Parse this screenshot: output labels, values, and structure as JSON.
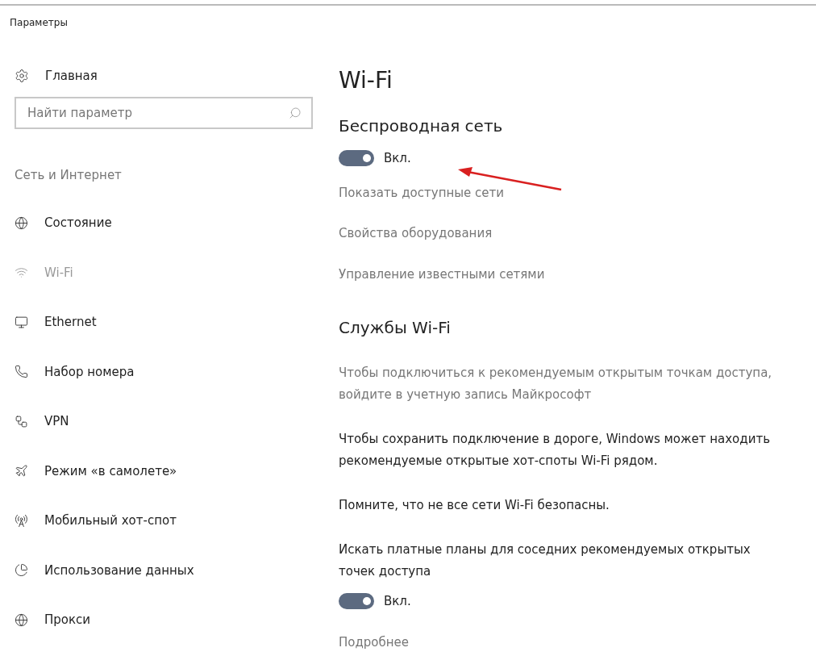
{
  "window": {
    "title": "Параметры"
  },
  "sidebar": {
    "home": "Главная",
    "search": {
      "placeholder": "Найти параметр"
    },
    "section": "Сеть и Интернет",
    "items": [
      {
        "label": "Состояние",
        "selected": false
      },
      {
        "label": "Wi-Fi",
        "selected": true
      },
      {
        "label": "Ethernet",
        "selected": false
      },
      {
        "label": "Набор номера",
        "selected": false
      },
      {
        "label": "VPN",
        "selected": false
      },
      {
        "label": "Режим «в самолете»",
        "selected": false
      },
      {
        "label": "Мобильный хот-спот",
        "selected": false
      },
      {
        "label": "Использование данных",
        "selected": false
      },
      {
        "label": "Прокси",
        "selected": false
      }
    ]
  },
  "main": {
    "title": "Wi-Fi",
    "wireless": {
      "heading": "Беспроводная сеть",
      "toggle": {
        "on": true,
        "label": "Вкл."
      }
    },
    "links": [
      "Показать доступные сети",
      "Свойства оборудования",
      "Управление известными сетями"
    ],
    "services": {
      "heading": "Службы Wi-Fi",
      "blocks": [
        {
          "kind": "link",
          "text": "Чтобы подключиться к рекомендуемым открытым точкам доступа, войдите в учетную запись Майкрософт"
        },
        {
          "kind": "text",
          "text": "Чтобы сохранить подключение в дороге, Windows может находить рекомендуемые открытые хот-споты Wi-Fi рядом."
        },
        {
          "kind": "text",
          "text": "Помните, что не все сети Wi-Fi безопасны."
        },
        {
          "kind": "text",
          "text": "Искать платные планы для соседних рекомендуемых открытых точек доступа"
        }
      ],
      "toggle": {
        "on": true,
        "label": "Вкл."
      },
      "more": "Подробнее"
    }
  }
}
